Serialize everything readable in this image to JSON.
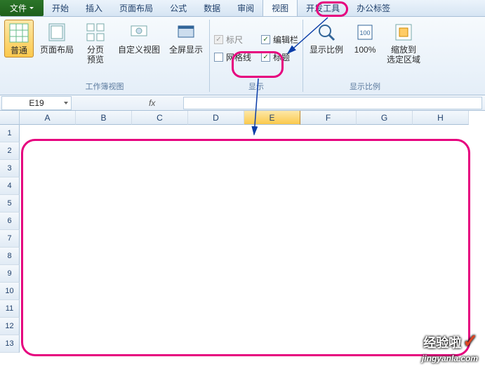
{
  "menu": {
    "file": "文件",
    "tabs": [
      "开始",
      "插入",
      "页面布局",
      "公式",
      "数据",
      "审阅",
      "视图",
      "开发工具",
      "办公标签"
    ],
    "active_index": 6
  },
  "ribbon": {
    "group_workbook_views": {
      "label": "工作簿视图",
      "normal": "普通",
      "page_layout": "页面布局",
      "page_break": "分页\n预览",
      "custom_views": "自定义视图",
      "full_screen": "全屏显示"
    },
    "group_show": {
      "label": "显示",
      "ruler": "标尺",
      "gridlines": "网格线",
      "formula_bar": "编辑栏",
      "headings": "标题",
      "ruler_checked": true,
      "gridlines_checked": false,
      "formula_bar_checked": true,
      "headings_checked": true
    },
    "group_zoom": {
      "label": "显示比例",
      "zoom": "显示比例",
      "hundred": "100%",
      "to_selection": "缩放到\n选定区域"
    }
  },
  "namebox": {
    "cell": "E19",
    "fx": "fx"
  },
  "columns": [
    "A",
    "B",
    "C",
    "D",
    "E",
    "F",
    "G",
    "H"
  ],
  "rows": [
    "1",
    "2",
    "3",
    "4",
    "5",
    "6",
    "7",
    "8",
    "9",
    "10",
    "11",
    "12",
    "13"
  ],
  "selected_col": "E",
  "watermark": {
    "title": "经验啦",
    "url": "jingyanla.com"
  }
}
